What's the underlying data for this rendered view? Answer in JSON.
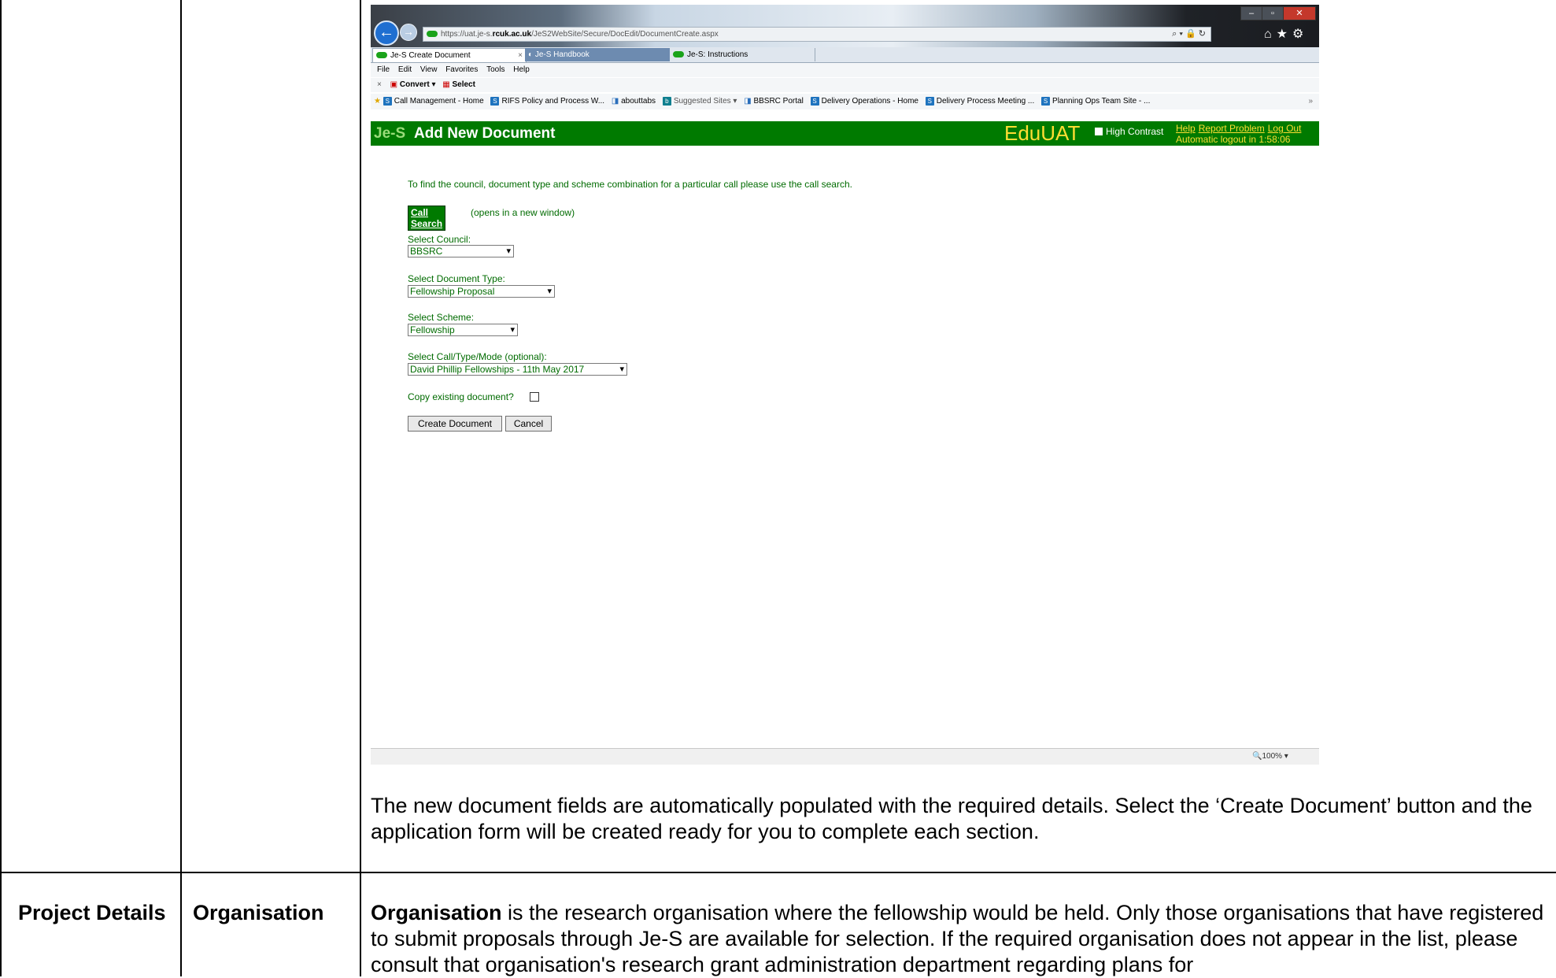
{
  "browser": {
    "url_prefix": "https://uat.je-s.",
    "url_host": "rcuk.ac.uk",
    "url_path": "/JeS2WebSite/Secure/DocEdit/DocumentCreate.aspx",
    "addr_icons": "⌕ ▾ 🔒 ↻",
    "nav_icons": "⌂★⚙",
    "tabs": [
      {
        "label": "Je-S Create Document"
      },
      {
        "label": "Je-S Handbook"
      },
      {
        "label": "Je-S: Instructions"
      }
    ],
    "menu": [
      "File",
      "Edit",
      "View",
      "Favorites",
      "Tools",
      "Help"
    ],
    "command_bar": {
      "convert": "Convert",
      "select": "Select"
    },
    "favorites": [
      "Call Management - Home",
      "RIFS Policy and Process W...",
      "abouttabs",
      "Suggested Sites ▾",
      "BBSRC Portal",
      "Delivery Operations - Home",
      "Delivery Process Meeting ...",
      "Planning Ops Team Site - ..."
    ],
    "zoom": "100%"
  },
  "jes": {
    "logo": "Je-S",
    "title": "Add New Document",
    "environment": "EduUAT",
    "high_contrast": "High Contrast",
    "links": [
      "Help",
      "Report Problem",
      "Log Out"
    ],
    "logout_timer": "Automatic logout in 1:58:06"
  },
  "form": {
    "intro": "To find the council, document type and scheme combination for a particular call please use the call search.",
    "call_search_button": "Call Search",
    "call_search_note": "(opens in a new window)",
    "council_label": "Select Council:",
    "council_value": "BBSRC",
    "doctype_label": "Select Document Type:",
    "doctype_value": "Fellowship Proposal",
    "scheme_label": "Select Scheme:",
    "scheme_value": "Fellowship",
    "call_label": "Select Call/Type/Mode (optional):",
    "call_value": "David Phillip Fellowships - 11th May 2017",
    "copy_label": "Copy existing document?",
    "create_button": "Create Document",
    "cancel_button": "Cancel"
  },
  "document": {
    "caption": "The new document fields are automatically populated with the required details. Select the ‘Create Document’ button and the application form will be created ready for you to complete each section.",
    "row2_col1": "Project Details",
    "row2_col2": "Organisation",
    "row2_term": "Organisation",
    "row2_text": " is the research organisation where the fellowship would be held.  Only those organisations that have registered to submit proposals through Je-S are available for selection.  If the required organisation does not appear in the list, please consult that organisation's research grant administration department regarding plans for"
  }
}
